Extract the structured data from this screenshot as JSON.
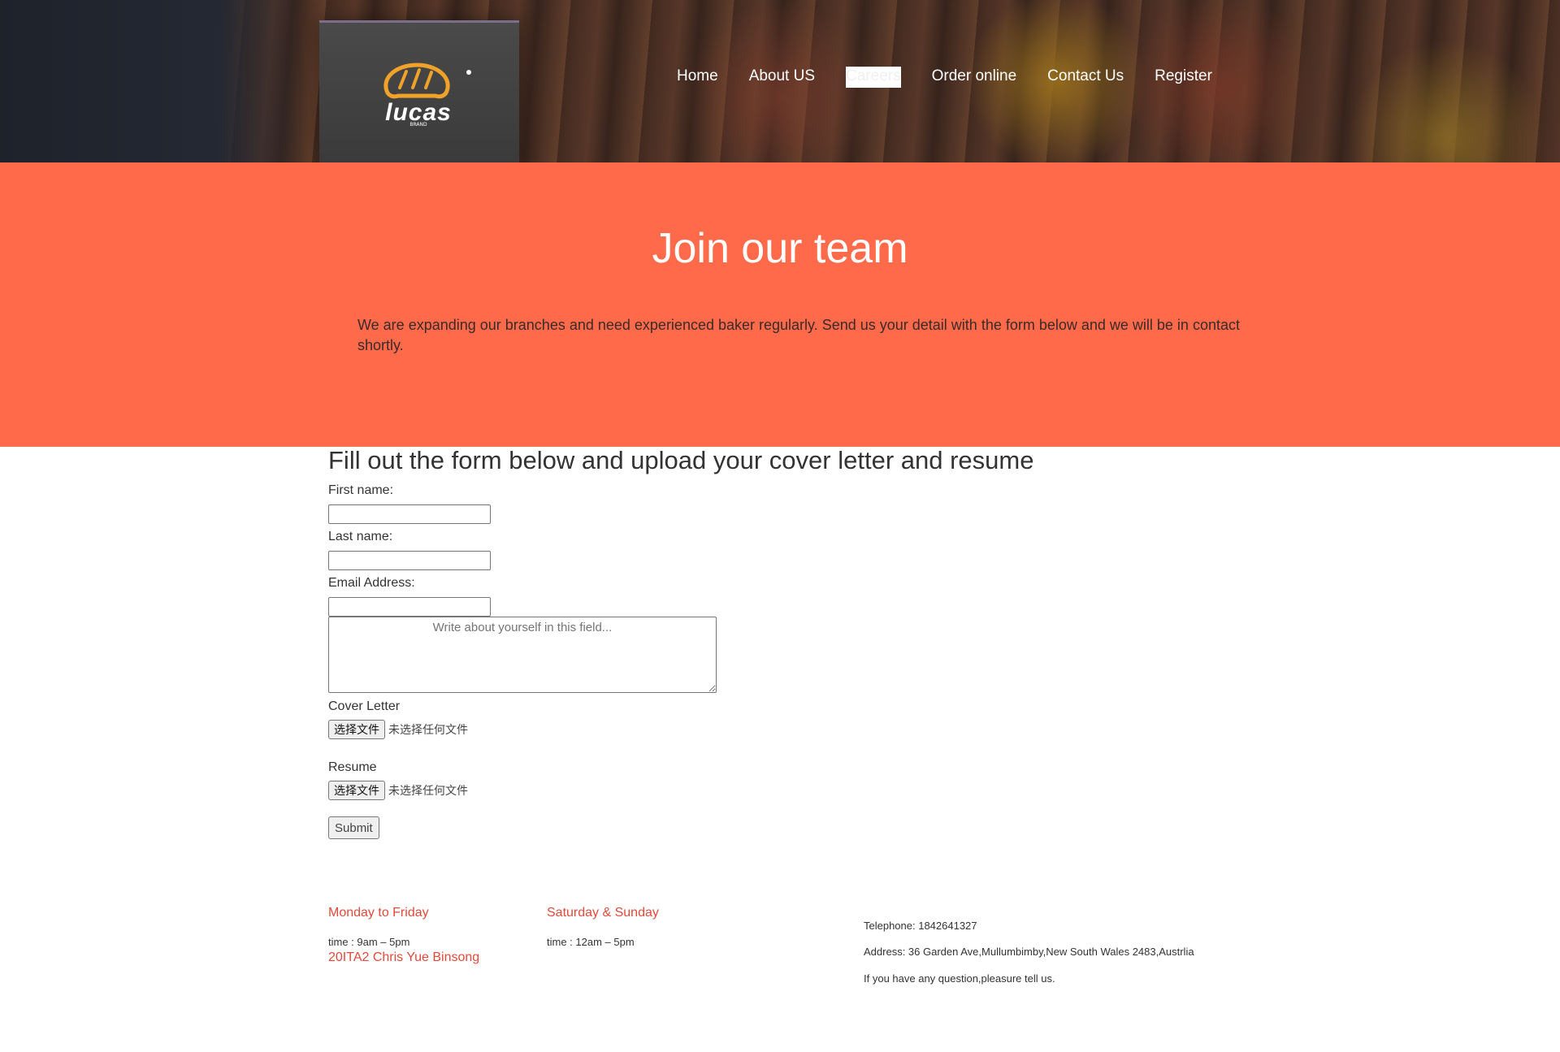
{
  "brand": {
    "name": "lucas",
    "tagline": "BRAND"
  },
  "nav": {
    "items": [
      {
        "label": "Home",
        "active": false
      },
      {
        "label": "About US",
        "active": false
      },
      {
        "label": "Careers",
        "active": true
      },
      {
        "label": "Order online",
        "active": false
      },
      {
        "label": "Contact Us",
        "active": false
      },
      {
        "label": "Register",
        "active": false
      }
    ]
  },
  "hero": {
    "title": "Join our team",
    "text": "We are expanding our branches and need experienced baker regularly. Send us your detail with the form below and we will be in contact shortly."
  },
  "form": {
    "heading": "Fill out the form below and upload your cover letter and resume",
    "first_name_label": "First name:",
    "first_name_value": "",
    "last_name_label": "Last name:",
    "last_name_value": "",
    "email_label": "Email Address:",
    "email_value": "",
    "about_placeholder": "Write about yourself in this field...",
    "cover_letter_label": "Cover Letter",
    "resume_label": "Resume",
    "file_button_label": "选择文件",
    "file_status": "未选择任何文件",
    "submit_label": "Submit"
  },
  "footer": {
    "weekday_heading": "Monday to Friday",
    "weekday_time": "time : 9am – 5pm",
    "weekend_heading": "Saturday & Sunday",
    "weekend_time": "time : 12am – 5pm",
    "author": "20ITA2 Chris Yue Binsong",
    "telephone": "Telephone: 1842641327",
    "address": "Address: 36 Garden Ave,Mullumbimby,New South Wales 2483,Austrlia",
    "question": "If you have any question,pleasure tell us."
  },
  "colors": {
    "accent": "#ff6a4a",
    "footer_heading": "#e24a3b"
  }
}
